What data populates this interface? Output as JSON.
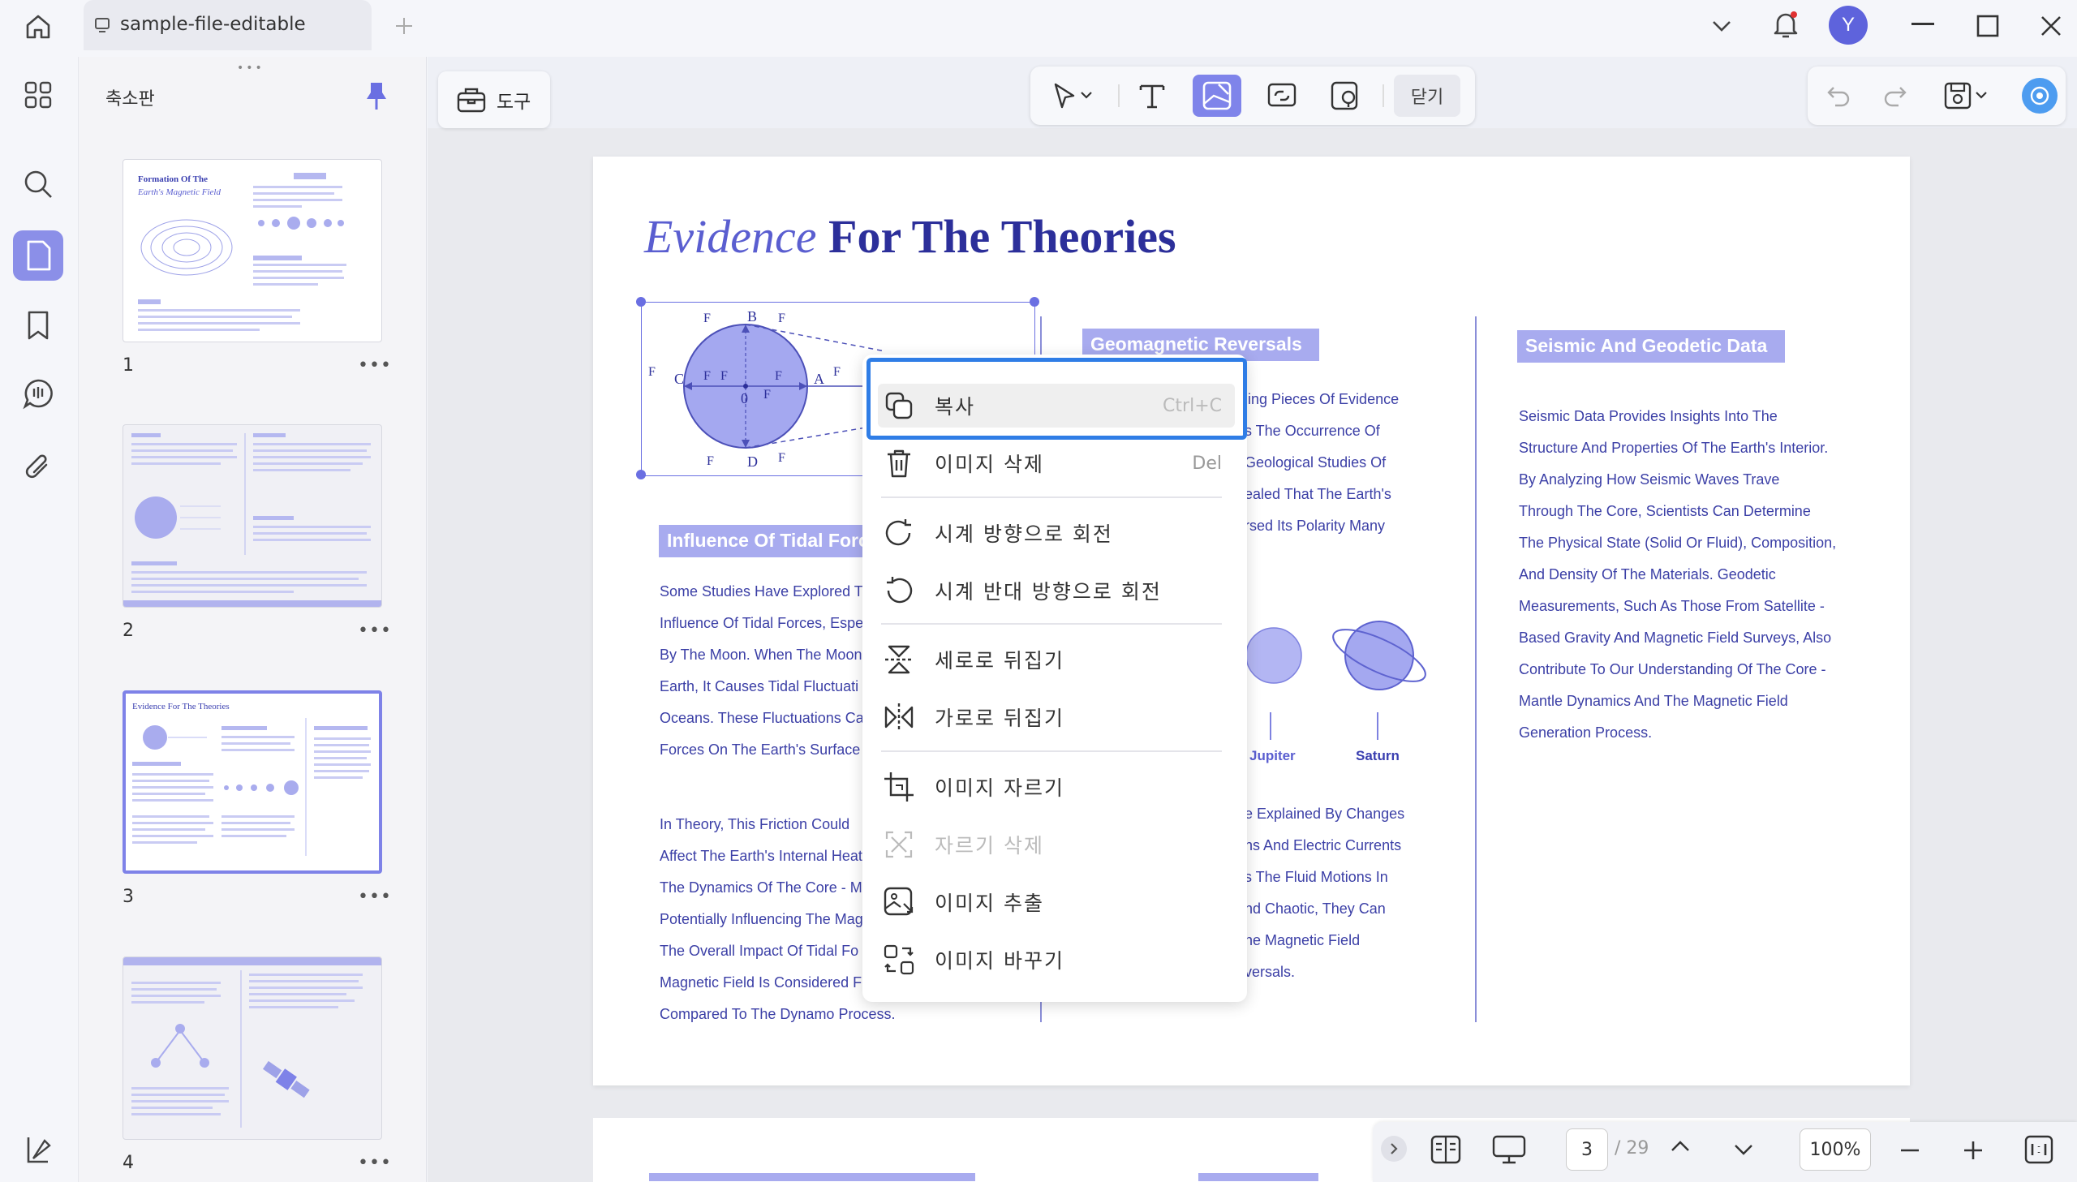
{
  "tab": {
    "title": "sample-file-editable"
  },
  "avatar": {
    "initial": "Y",
    "color": "#5e63dc"
  },
  "accent": "#7f84ea",
  "sidebar": {
    "title": "축소판",
    "pages": [
      "1",
      "2",
      "3",
      "4"
    ],
    "more": "•••"
  },
  "toolbar": {
    "tools_label": "도구",
    "close_label": "닫기"
  },
  "page": {
    "title_italic": "Evidence",
    "title_bold": "For The Theories",
    "diagram_labels": [
      "B",
      "A",
      "C",
      "D",
      "0"
    ],
    "heading_tidal": "Influence Of Tidal Forces",
    "tidal_para1": [
      "Some Studies Have Explored T",
      "Influence Of Tidal Forces, Espe",
      "By The Moon. When The Moon",
      "Earth, It Causes Tidal Fluctuati",
      "Oceans. These Fluctuations Ca",
      "Forces On The Earth's Surface"
    ],
    "tidal_para2": [
      " In Theory, This Friction Could",
      "Affect The Earth's Internal Heat",
      "The Dynamics Of The Core - M",
      "Potentially Influencing The Mag",
      "The Overall Impact Of Tidal Fo",
      "Magnetic Field Is Considered F",
      "Compared To The Dynamo Process."
    ],
    "heading_geomag": "Geomagnetic Reversals",
    "geomag_para1": [
      "ling Pieces Of Evidence",
      "s The Occurrence Of",
      "Geological Studies Of",
      "ealed That The Earth's",
      "rsed Its Polarity Many"
    ],
    "planet_labels": [
      "Jupiter",
      "Saturn"
    ],
    "geomag_para2": [
      "e Explained By Changes",
      "ns And Electric Currents",
      "s The Fluid Motions In",
      "nd Chaotic, They Can",
      "he Magnetic Field",
      "versals."
    ],
    "heading_seismic": "Seismic And Geodetic Data",
    "seismic_para": [
      "Seismic Data Provides Insights Into The",
      "Structure And Properties Of The Earth's Interior.",
      "By Analyzing How Seismic Waves Trave",
      "Through The Core, Scientists Can Determine",
      "The Physical State (Solid Or Fluid), Composition,",
      "And Density Of The Materials. Geodetic",
      "Measurements, Such As Those From Satellite -",
      "Based Gravity And Magnetic Field Surveys, Also",
      "Contribute To Our Understanding Of The Core -",
      "Mantle Dynamics And The Magnetic Field",
      "Generation Process."
    ]
  },
  "thumbnails": {
    "t1_title1": "Formation Of The",
    "t1_title2": "Earth's Magnetic Field",
    "t3_title": "Evidence For The Theories"
  },
  "context_menu": {
    "copy": {
      "label": "복사",
      "shortcut": "Ctrl+C"
    },
    "delete": {
      "label": "이미지 삭제",
      "shortcut": "Del"
    },
    "rotate_cw": {
      "label": "시계 방향으로 회전"
    },
    "rotate_ccw": {
      "label": "시계 반대 방향으로 회전"
    },
    "flip_v": {
      "label": "세로로 뒤집기"
    },
    "flip_h": {
      "label": "가로로 뒤집기"
    },
    "crop": {
      "label": "이미지 자르기"
    },
    "crop_delete": {
      "label": "자르기 삭제"
    },
    "extract": {
      "label": "이미지 추출"
    },
    "replace": {
      "label": "이미지 바꾸기"
    }
  },
  "bottom": {
    "current_page": "3",
    "total_pages": "/ 29",
    "zoom": "100%"
  }
}
